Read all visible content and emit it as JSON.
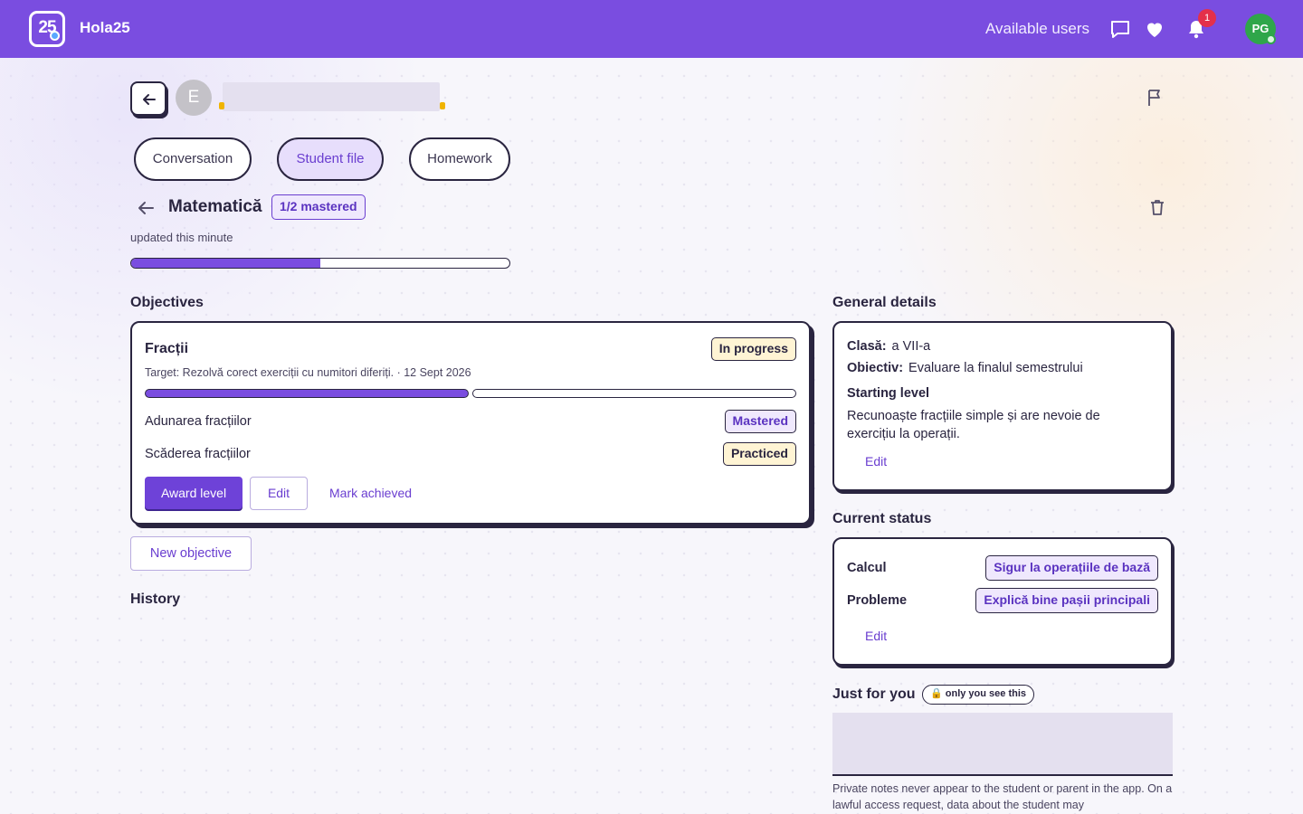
{
  "app": {
    "logo_text": "25",
    "name": "Hola25",
    "available_users": "Available users",
    "notification_count": "1",
    "user_initials": "PG"
  },
  "student": {
    "avatar_letter": "E"
  },
  "tabs": [
    {
      "label": "Conversation",
      "active": false
    },
    {
      "label": "Student file",
      "active": true
    },
    {
      "label": "Homework",
      "active": false
    }
  ],
  "subject": {
    "title": "Matematică",
    "mastered_badge": "1/2 mastered",
    "updated": "updated this minute",
    "progress": 0.5
  },
  "objectives": {
    "heading": "Objectives",
    "items": [
      {
        "title": "Fracții",
        "status": "In progress",
        "target": "Target: Rezolvă corect exerciții cu numitori diferiți. · 12 Sept 2026",
        "segments_done": 1,
        "segments_total": 2,
        "skills": [
          {
            "label": "Adunarea fracțiilor",
            "status": "Mastered"
          },
          {
            "label": "Scăderea fracțiilor",
            "status": "Practiced"
          }
        ],
        "award_label": "Award level",
        "edit_label": "Edit",
        "mark_label": "Mark achieved"
      }
    ],
    "new_button": "New objective"
  },
  "history": {
    "heading": "History"
  },
  "general": {
    "heading": "General details",
    "class_label": "Clasă:",
    "class_value": "a VII-a",
    "goal_label": "Obiectiv:",
    "goal_value": "Evaluare la finalul semestrului",
    "starting_heading": "Starting level",
    "starting_text": "Recunoaște fracțiile simple și are nevoie de exercițiu la operații.",
    "edit_label": "Edit"
  },
  "current_status": {
    "heading": "Current status",
    "rows": [
      {
        "label": "Calcul",
        "value": "Sigur la operațiile de bază"
      },
      {
        "label": "Probleme",
        "value": "Explică bine pașii principali"
      }
    ],
    "edit_label": "Edit"
  },
  "just_for_you": {
    "heading": "Just for you",
    "private_badge": "🔒 only you see this",
    "note": "Private notes never appear to the student or parent in the app. On a lawful access request, data about the student may"
  },
  "colors": {
    "brand": "#7a4de0",
    "accent_text": "#6a3ed0",
    "ink": "#2a2540",
    "badge_red": "#e4304a",
    "avatar_green": "#2fa64a"
  }
}
